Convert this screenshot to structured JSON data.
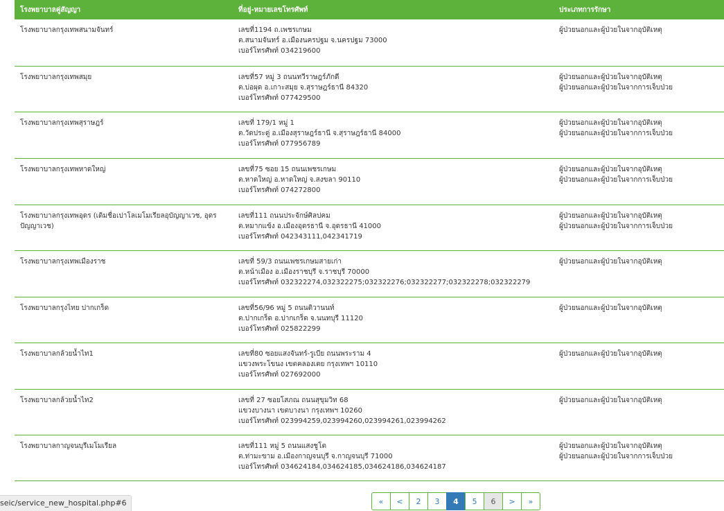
{
  "table": {
    "headers": [
      "โรงพยาบาลคู่สัญญา",
      "ที่อยู่-หมายเลขโทรศัพท์",
      "ประเภทการรักษา"
    ],
    "rows": [
      {
        "name": "โรงพยาบาลกรุงเทพสนามจันทร์",
        "address": [
          "เลขที่1194 ถ.เพชรเกษม",
          "ต.สนามจันทร์ อ.เมืองนครปฐม จ.นครปฐม 73000",
          "เบอร์โทรศัพท์ 034219600"
        ],
        "types": [
          "ผู้ป่วยนอกและผู้ป่วยในจากอุบัติเหตุ"
        ]
      },
      {
        "name": "โรงพยาบาลกรุงเทพสมุย",
        "address": [
          "เลขที่57 หมู่ 3 ถนนทวีราษฎร์ภักดี",
          "ต.บ่อผุด อ.เกาะสมุย จ.สุราษฎร์ธานี 84320",
          "เบอร์โทรศัพท์ 077429500"
        ],
        "types": [
          "ผู้ป่วยนอกและผู้ป่วยในจากอุบัติเหตุ",
          "ผู้ป่วยนอกและผู้ป่วยในจากการเจ็บป่วย"
        ]
      },
      {
        "name": "โรงพยาบาลกรุงเทพสุราษฎร์",
        "address": [
          "เลขที่ 179/1 หมู่ 1",
          "ต.วัดประดู่ อ.เมืองสุราษฎร์ธานี จ.สุราษฎร์ธานี 84000",
          "เบอร์โทรศัพท์ 077956789"
        ],
        "types": [
          "ผู้ป่วยนอกและผู้ป่วยในจากอุบัติเหตุ",
          "ผู้ป่วยนอกและผู้ป่วยในจากการเจ็บป่วย"
        ]
      },
      {
        "name": "โรงพยาบาลกรุงเทพหาดใหญ่",
        "address": [
          "เลขที่75 ซอย 15 ถนนเพชรเกษม",
          "ต.หาดใหญ่ อ.หาดใหญ่ จ.สงขลา 90110",
          "เบอร์โทรศัพท์ 074272800"
        ],
        "types": [
          "ผู้ป่วยนอกและผู้ป่วยในจากอุบัติเหตุ",
          "ผู้ป่วยนอกและผู้ป่วยในจากการเจ็บป่วย"
        ]
      },
      {
        "name": "โรงพยาบาลกรุงเทพอุดร (เดิมชื่อเปาโลเมโมเรียลอุบัญญาเวช, อุดรปัญญาเวช)",
        "address": [
          "เลขที่111 ถนนประจักษ์ศิลปคม",
          "ต.หมากแข้ง อ.เมืองอุดรธานี จ.อุดรธานี 41000",
          "เบอร์โทรศัพท์ 042343111,042341719"
        ],
        "types": [
          "ผู้ป่วยนอกและผู้ป่วยในจากอุบัติเหตุ",
          "ผู้ป่วยนอกและผู้ป่วยในจากการเจ็บป่วย"
        ]
      },
      {
        "name": "โรงพยาบาลกรุงเทพเมืองราช",
        "address": [
          "เลขที่ 59/3 ถนนเพชรเกษมสายเก่า",
          "ต.หน้าเมือง อ.เมืองราชบุรี จ.ราชบุรี 70000",
          "เบอร์โทรศัพท์ 032322274,032322275;032322276;032322277;032322278;032322279"
        ],
        "types": [
          "ผู้ป่วยนอกและผู้ป่วยในจากอุบัติเหตุ"
        ]
      },
      {
        "name": "โรงพยาบาลกรุงไทย ปากเกร็ด",
        "address": [
          "เลขที่56/96 หมู่ 5 ถนนติวานนท์",
          "ต.ปากเกร็ด อ.ปากเกร็ด จ.นนทบุรี 11120",
          "เบอร์โทรศัพท์ 025822299"
        ],
        "types": [
          "ผู้ป่วยนอกและผู้ป่วยในจากอุบัติเหตุ"
        ]
      },
      {
        "name": "โรงพยาบาลกล้วยน้ำไท1",
        "address": [
          "เลขที่80 ซอยแสงจันทร์-รูเบีย ถนนพระราม 4",
          "แขวงพระโขนง เขตคลองเตย กรุงเทพฯ 10110",
          "เบอร์โทรศัพท์ 027692000"
        ],
        "types": [
          "ผู้ป่วยนอกและผู้ป่วยในจากอุบัติเหตุ"
        ]
      },
      {
        "name": "โรงพยาบาลกล้วยน้ำไท2",
        "address": [
          "เลขที่ 27 ซอยโสภณ ถนนสุขุมวิท 68",
          "แขวงบางนา เขตบางนา กรุงเทพฯ 10260",
          "เบอร์โทรศัพท์ 023994259,023994260,023994261,023994262"
        ],
        "types": [
          "ผู้ป่วยนอกและผู้ป่วยในจากอุบัติเหตุ"
        ]
      },
      {
        "name": "โรงพยาบาลกาญจนบุรีเมโมเรียล",
        "address": [
          "เลขที่111 หมู่ 5 ถนนแสงชูโต",
          "ต.ท่ามะขาม อ.เมืองกาญจนบุรี จ.กาญจนบุรี 71000",
          "เบอร์โทรศัพท์ 034624184,034624185,034624186,034624187"
        ],
        "types": [
          "ผู้ป่วยนอกและผู้ป่วยในจากอุบัติเหตุ",
          "ผู้ป่วยนอกและผู้ป่วยในจากการเจ็บป่วย"
        ]
      }
    ]
  },
  "status_url": "seic/service_new_hospital.php#6",
  "pagination": {
    "pages": [
      {
        "label": "«",
        "state": "normal",
        "name": "first-page-button"
      },
      {
        "label": "<",
        "state": "normal",
        "name": "prev-page-button"
      },
      {
        "label": "2",
        "state": "normal",
        "name": "page-2-button"
      },
      {
        "label": "3",
        "state": "normal",
        "name": "page-3-button"
      },
      {
        "label": "4",
        "state": "active",
        "name": "page-4-button"
      },
      {
        "label": "5",
        "state": "normal",
        "name": "page-5-button"
      },
      {
        "label": "6",
        "state": "disabled",
        "name": "page-6-button"
      },
      {
        "label": ">",
        "state": "normal",
        "name": "next-page-button"
      },
      {
        "label": "»",
        "state": "normal",
        "name": "last-page-button"
      }
    ]
  },
  "colors": {
    "header_bg": "#5cb23b",
    "row_border": "#5cb23b",
    "page_active": "#337ab7",
    "page_link": "#337ab7"
  }
}
